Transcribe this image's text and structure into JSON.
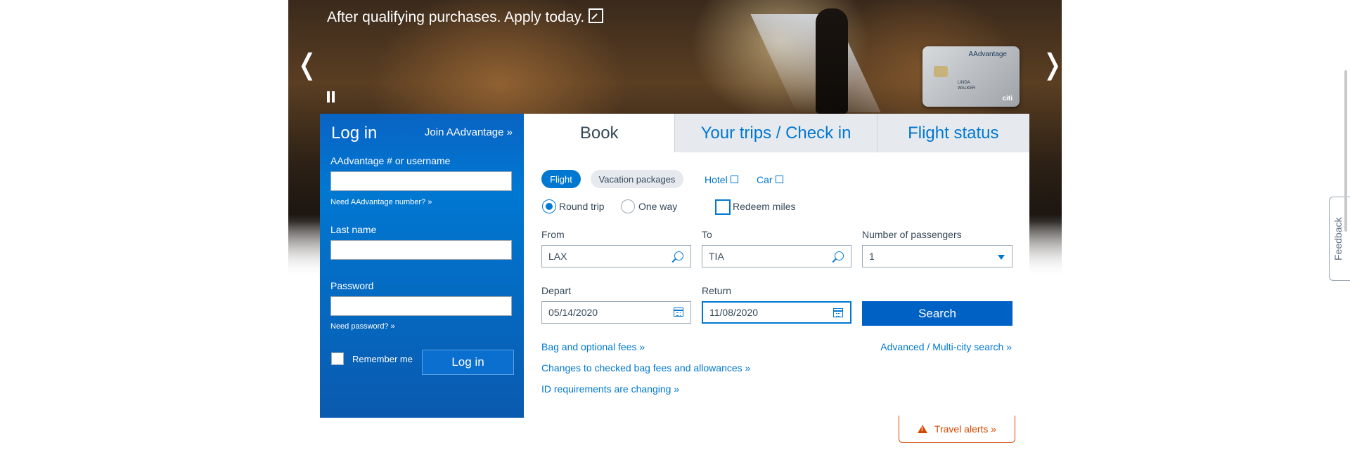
{
  "hero": {
    "caption": "After qualifying purchases. Apply today.",
    "card_brand": "AAdvantage",
    "card_holder_line1": "LINDA",
    "card_holder_line2": "WALKER",
    "card_issuer": "citi",
    "prev_arrow": "❬",
    "next_arrow": "❭"
  },
  "login": {
    "title": "Log in",
    "join_link": "Join AAdvantage »",
    "username_label": "AAdvantage # or username",
    "username_value": "",
    "need_number_link": "Need AAdvantage number? »",
    "lastname_label": "Last name",
    "lastname_value": "",
    "password_label": "Password",
    "password_value": "",
    "need_password_link": "Need password? »",
    "remember_label": "Remember me",
    "remember_checked": false,
    "submit_label": "Log in"
  },
  "booking": {
    "tabs": [
      {
        "label": "Book",
        "active": true
      },
      {
        "label": "Your trips / Check in",
        "active": false
      },
      {
        "label": "Flight status",
        "active": false
      }
    ],
    "trip_types": {
      "flight": "Flight",
      "vacation": "Vacation packages",
      "hotel": "Hotel",
      "car": "Car"
    },
    "round_trip_label": "Round trip",
    "one_way_label": "One way",
    "selected_trip": "Round trip",
    "redeem_label": "Redeem miles",
    "redeem_checked": false,
    "from_label": "From",
    "from_value": "LAX",
    "to_label": "To",
    "to_value": "TIA",
    "passengers_label": "Number of passengers",
    "passengers_value": "1",
    "depart_label": "Depart",
    "depart_value": "05/14/2020",
    "return_label": "Return",
    "return_value": "11/08/2020",
    "search_label": "Search",
    "bag_fees_link": "Bag and optional fees »",
    "advanced_link": "Advanced / Multi-city search »",
    "bag_changes_link": "Changes to checked bag fees and allowances »",
    "id_link": "ID requirements are changing »"
  },
  "travel_alerts": "Travel alerts »",
  "feedback": "Feedback",
  "colors": {
    "brand_blue": "#0078d2",
    "login_blue": "#0a63c3",
    "alert_orange": "#d14900",
    "tab_inactive_bg": "#e6eaee"
  }
}
